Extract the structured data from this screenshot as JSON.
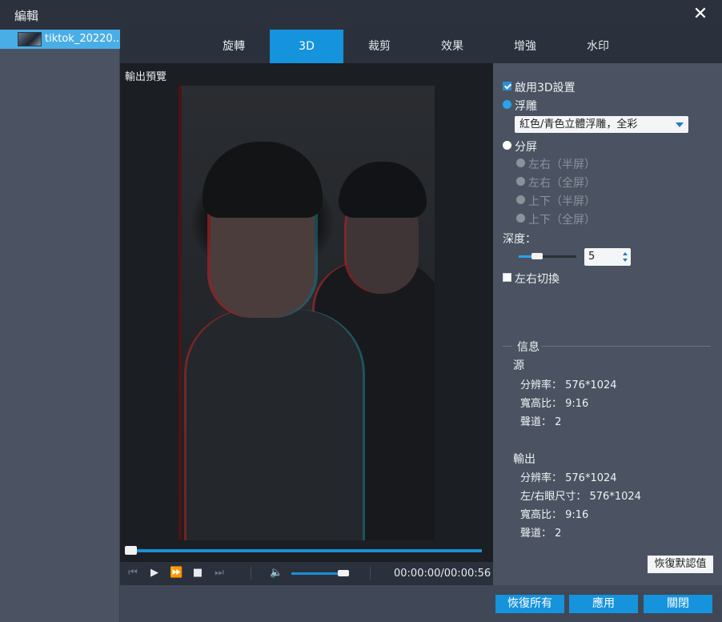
{
  "window": {
    "title": "編輯",
    "close_icon": "close-icon"
  },
  "sidebar": {
    "files": [
      {
        "name": "tiktok_20220...",
        "selected": true
      }
    ]
  },
  "tabs": [
    {
      "label": "旋轉",
      "active": false
    },
    {
      "label": "3D",
      "active": true
    },
    {
      "label": "裁剪",
      "active": false
    },
    {
      "label": "效果",
      "active": false
    },
    {
      "label": "增強",
      "active": false
    },
    {
      "label": "水印",
      "active": false
    }
  ],
  "preview": {
    "label": "輸出預覽",
    "progress": 0.0,
    "time": "00:00:00/00:00:56",
    "volume": 0.9,
    "controls": [
      "skip-back-icon",
      "play-icon",
      "fast-forward-icon",
      "stop-icon",
      "skip-forward-icon",
      "volume-icon"
    ]
  },
  "settings3d": {
    "enable_label": "啟用3D設置",
    "enable_checked": true,
    "anaglyph_label": "浮雕",
    "anaglyph_selected": true,
    "anaglyph_option": "紅色/青色立體浮雕，全彩",
    "split_label": "分屏",
    "split_selected": false,
    "split_options": [
      "左右（半屏）",
      "左右（全屏）",
      "上下（半屏）",
      "上下（全屏）"
    ],
    "depth_label": "深度：",
    "depth_value": "5",
    "swap_label": "左右切換",
    "swap_checked": false
  },
  "info": {
    "title": "信息",
    "source": {
      "title": "源",
      "resolution": "分辨率： 576*1024",
      "aspect": "寬高比： 9:16",
      "channels": "聲道： 2"
    },
    "output": {
      "title": "輸出",
      "resolution": "分辨率： 576*1024",
      "eye_size": "左/右眼尺寸： 576*1024",
      "aspect": "寬高比： 9:16",
      "channels": "聲道： 2"
    },
    "reset_defaults": "恢復默認值"
  },
  "footer": {
    "restore_all": "恢復所有",
    "apply": "應用",
    "close": "關閉"
  },
  "colors": {
    "accent": "#1593dd",
    "panel": "#4b5362",
    "dark": "#2b313c"
  }
}
